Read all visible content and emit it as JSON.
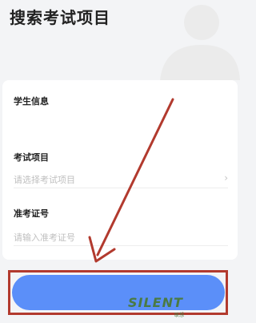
{
  "header": {
    "title": "搜索考试项目"
  },
  "form": {
    "student_info_label": "学生信息",
    "exam_item_label": "考试项目",
    "exam_item_placeholder": "请选择考试项目",
    "ticket_label": "准考证号",
    "ticket_placeholder": "请输入准考证号"
  },
  "watermark": {
    "brand": "SILENT",
    "sub": "联想"
  },
  "colors": {
    "accent": "#5b8ff9",
    "annotation": "#b23a2e"
  },
  "icons": {
    "chevron": "chevron-right-icon"
  }
}
